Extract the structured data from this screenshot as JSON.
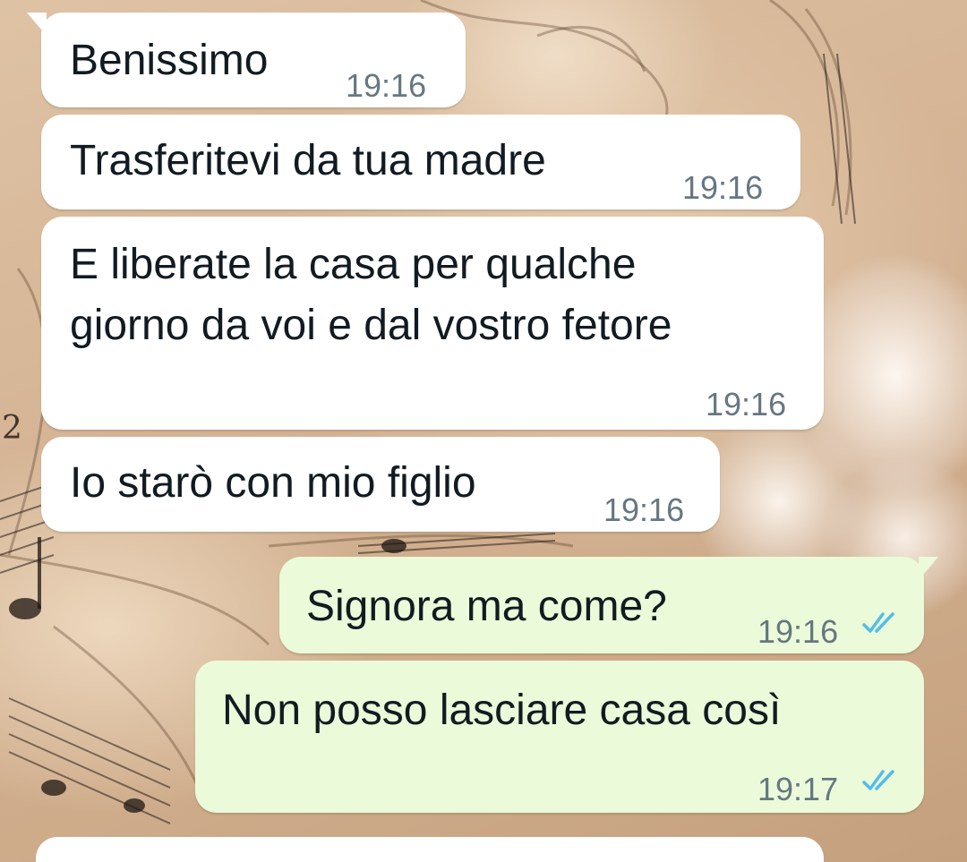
{
  "chat": {
    "messages": [
      {
        "direction": "incoming",
        "text": "Benissimo",
        "time": "19:16"
      },
      {
        "direction": "incoming",
        "text": "Trasferitevi da tua madre",
        "time": "19:16"
      },
      {
        "direction": "incoming",
        "lines": [
          "E liberate la casa per qualche",
          "giorno da voi e dal vostro fetore"
        ],
        "time": "19:16"
      },
      {
        "direction": "incoming",
        "text": "Io starò con mio figlio",
        "time": "19:16"
      },
      {
        "direction": "outgoing",
        "text": "Signora ma come?",
        "time": "19:16",
        "status_icon": "double-check-read-icon"
      },
      {
        "direction": "outgoing",
        "text": "Non posso lasciare casa così",
        "time": "19:17",
        "status_icon": "double-check-read-icon"
      }
    ]
  },
  "colors": {
    "incoming_bubble": "#ffffff",
    "outgoing_bubble": "#ebfad8",
    "timestamp": "#667781",
    "read_ticks": "#53bdeb",
    "text": "#111b21"
  }
}
